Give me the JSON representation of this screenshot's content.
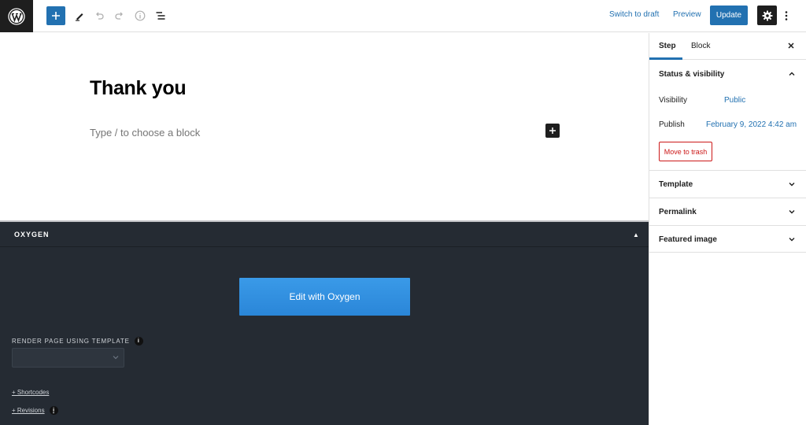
{
  "toolbar": {
    "switch_to_draft": "Switch to draft",
    "preview": "Preview",
    "update": "Update"
  },
  "editor": {
    "title": "Thank you",
    "placeholder": "Type / to choose a block"
  },
  "oxygen": {
    "title": "OXYGEN",
    "edit_button": "Edit with Oxygen",
    "render_label": "RENDER PAGE USING TEMPLATE",
    "template_value": "",
    "shortcodes_link": "+ Shortcodes",
    "revisions_link": "+ Revisions"
  },
  "sidebar": {
    "tabs": [
      {
        "label": "Step",
        "active": true
      },
      {
        "label": "Block",
        "active": false
      }
    ],
    "status_title": "Status & visibility",
    "visibility_label": "Visibility",
    "visibility_value": "Public",
    "publish_label": "Publish",
    "publish_value": "February 9, 2022 4:42 am",
    "trash_button": "Move to trash",
    "panels": [
      {
        "title": "Template"
      },
      {
        "title": "Permalink"
      },
      {
        "title": "Featured image"
      }
    ]
  },
  "colors": {
    "accent": "#2271b1",
    "danger": "#cc1818",
    "oxygen_bg": "#252b33",
    "oxygen_button": "#3a9ae8"
  },
  "icons": {
    "logo": "wordpress-logo",
    "add": "plus-icon",
    "tools": "pencil-icon",
    "undo": "undo-icon",
    "redo": "redo-icon",
    "details": "info-icon",
    "outline": "list-view-icon",
    "settings": "gear-icon",
    "options": "more-vertical-icon"
  }
}
